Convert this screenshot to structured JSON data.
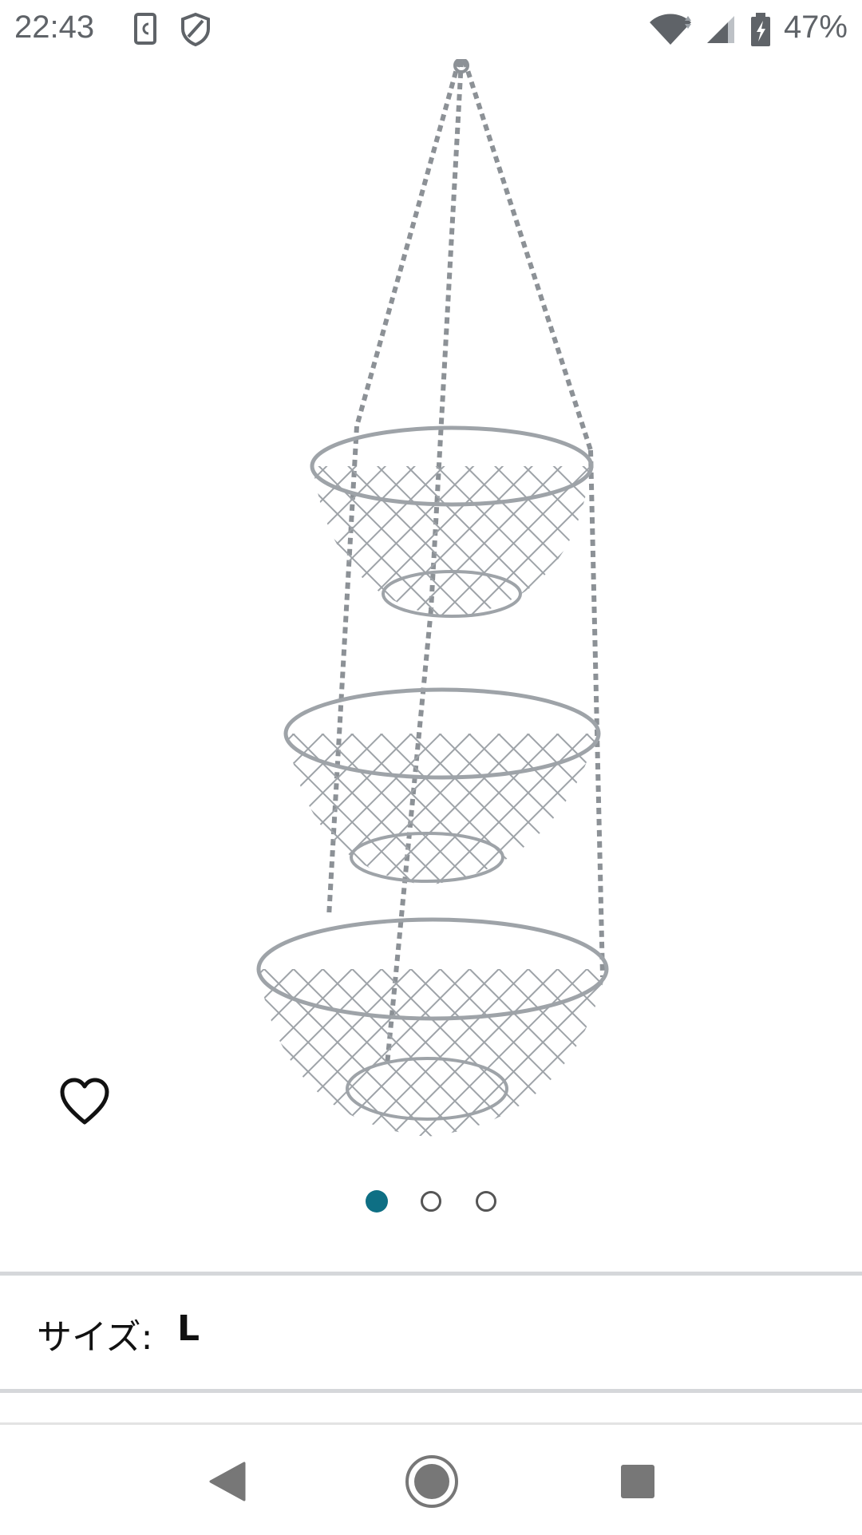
{
  "status_bar": {
    "time": "22:43",
    "battery_percent": "47%",
    "icons": [
      "screenshot-icon",
      "shield-icon",
      "wifi-icon",
      "cell-signal-icon",
      "battery-icon"
    ]
  },
  "product": {
    "image_subject": "three-tier-hanging-wire-basket",
    "favorite_icon": "heart-outline-icon"
  },
  "carousel": {
    "total": 3,
    "active_index": 0,
    "active_color": "#0e6f84"
  },
  "size": {
    "label": "サイズ:",
    "value": "L"
  },
  "nav_bar": {
    "icons": [
      "back-triangle-icon",
      "home-circle-icon",
      "recents-square-icon"
    ]
  }
}
